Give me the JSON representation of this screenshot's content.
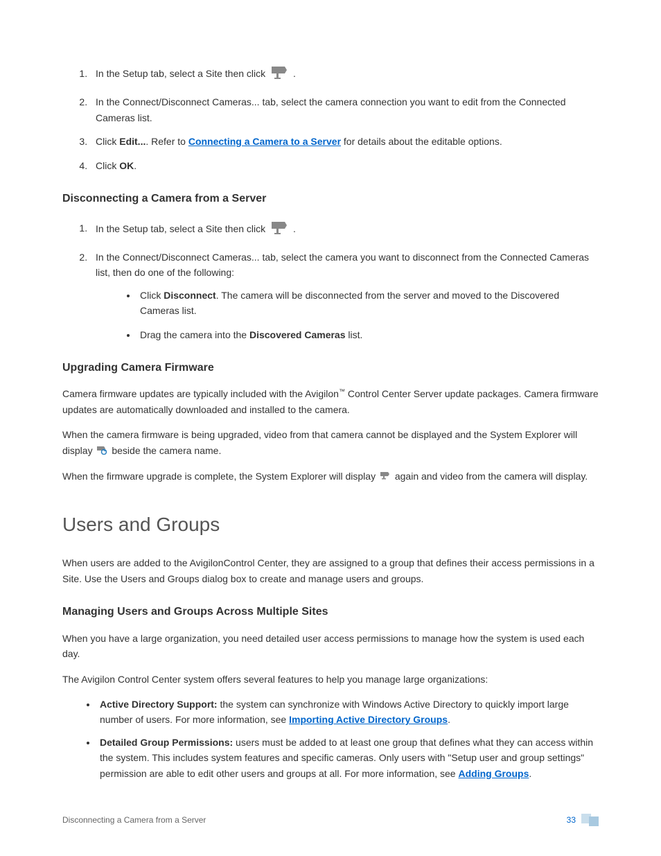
{
  "section1": {
    "item1_prefix": "In the Setup tab, select a Site then click ",
    "item1_suffix": ".",
    "item2": "In the Connect/Disconnect Cameras... tab, select the camera connection you want to edit from the Connected Cameras list.",
    "item3_prefix": "Click ",
    "item3_bold1": "Edit...",
    "item3_mid": ". Refer to ",
    "item3_link": "Connecting a Camera to a Server",
    "item3_suffix": " for details about the editable options.",
    "item4_prefix": "Click ",
    "item4_bold": "OK",
    "item4_suffix": "."
  },
  "heading_disconnect": "Disconnecting a Camera from a Server",
  "section2": {
    "item1_prefix": "In the Setup tab, select a Site then click ",
    "item1_suffix": ".",
    "item2": "In the Connect/Disconnect Cameras... tab, select the camera you want to disconnect from the Connected Cameras list, then do one of the following:",
    "bullet1_prefix": "Click ",
    "bullet1_bold": "Disconnect",
    "bullet1_suffix": ". The camera will be disconnected from the server and moved to the Discovered Cameras list.",
    "bullet2_prefix": "Drag the camera into the ",
    "bullet2_bold": "Discovered Cameras",
    "bullet2_suffix": " list."
  },
  "heading_firmware": "Upgrading Camera Firmware",
  "firmware": {
    "p1_prefix": "Camera firmware updates are typically included with the Avigilon",
    "p1_tm": "™",
    "p1_suffix": " Control Center Server update packages. Camera firmware updates are automatically downloaded and installed to the camera.",
    "p2_prefix": "When the camera firmware is being upgraded, video from that camera cannot be displayed and the System Explorer will display ",
    "p2_suffix": " beside the camera name.",
    "p3_prefix": "When the firmware upgrade is complete, the System Explorer will display ",
    "p3_suffix": " again and video from the camera will display."
  },
  "heading_users": "Users and Groups",
  "users_intro": "When users are added to the AvigilonControl Center, they are assigned to a group that defines their access permissions in a Site. Use the Users and Groups dialog box to create and manage users and groups.",
  "heading_managing": "Managing Users and Groups Across Multiple Sites",
  "managing": {
    "p1": "When you have a large organization, you need detailed user access permissions to manage how the system is used each day.",
    "p2": "The Avigilon Control Center system offers several features to help you manage large organizations:",
    "bullet1_bold": "Active Directory Support:",
    "bullet1_text": " the system can synchronize with Windows Active Directory to quickly import large number of users. For more information, see ",
    "bullet1_link": "Importing Active Directory Groups",
    "bullet1_suffix": ".",
    "bullet2_bold": "Detailed Group Permissions:",
    "bullet2_text": " users must be added to at least one group that defines what they can access within the system. This includes system features and specific cameras. Only users with \"Setup user and group settings\" permission are able to edit other users and groups at all. For more information, see ",
    "bullet2_link": "Adding Groups",
    "bullet2_suffix": "."
  },
  "footer": {
    "title": "Disconnecting a Camera from a Server",
    "page": "33"
  }
}
